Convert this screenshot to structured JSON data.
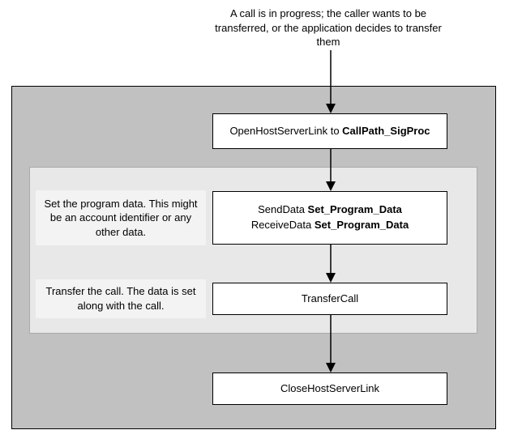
{
  "caption": "A call is in progress; the caller wants to be transferred, or the application decides to transfer them",
  "step1": {
    "plain": "OpenHostServerLink to ",
    "bold": "CallPath_SigProc"
  },
  "step2": {
    "line1_plain": "SendData  ",
    "line1_bold": "Set_Program_Data",
    "line2_plain": "ReceiveData  ",
    "line2_bold": "Set_Program_Data"
  },
  "step3": {
    "text": "TransferCall"
  },
  "step4": {
    "text": "CloseHostServerLink"
  },
  "note1": {
    "text": "Set the program data. This might be an account identifier or any other data."
  },
  "note2": {
    "text": "Transfer the call. The data is set along with the call."
  }
}
